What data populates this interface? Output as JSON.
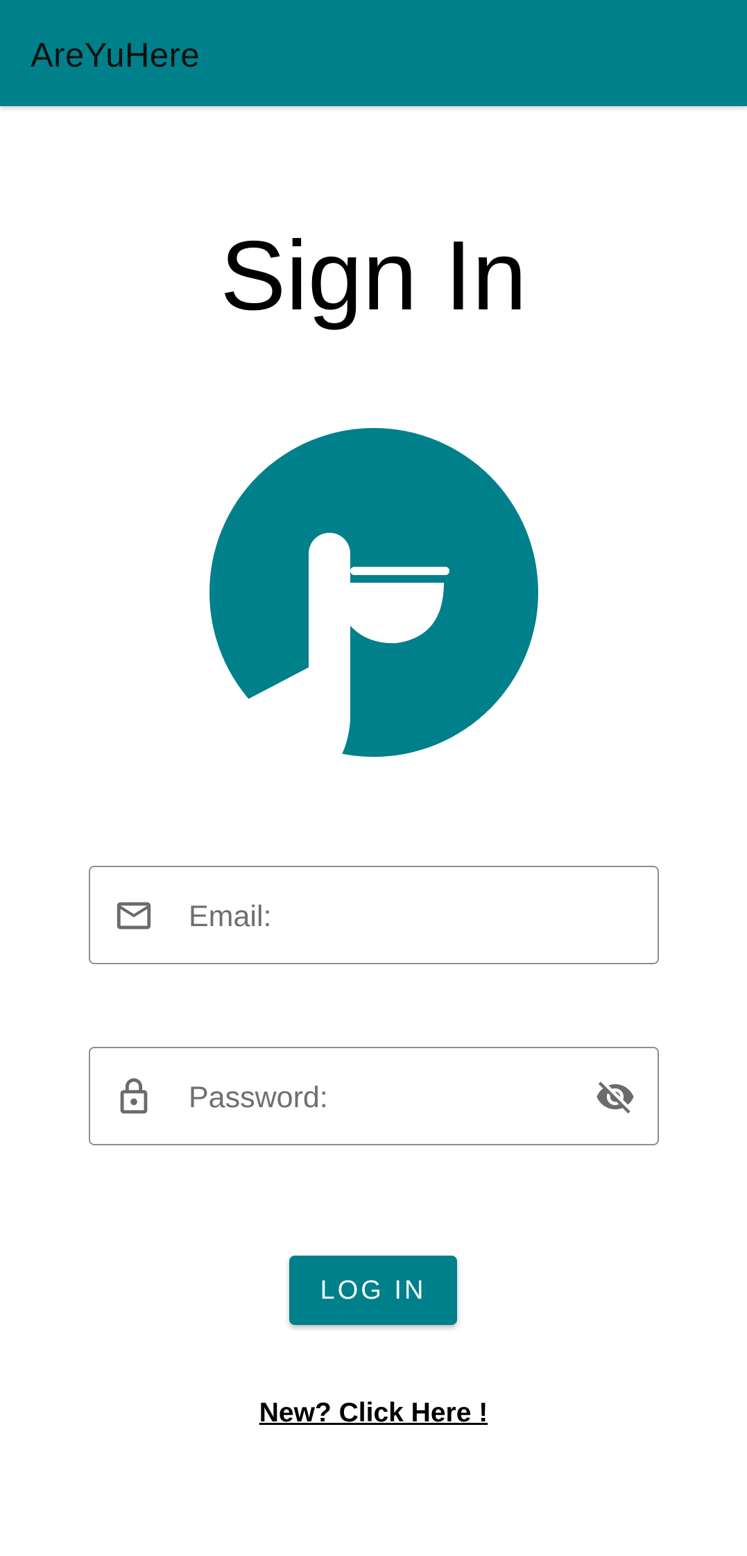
{
  "appbar": {
    "title": "AreYuHere"
  },
  "main": {
    "page_title": "Sign In",
    "email": {
      "placeholder": "Email:",
      "value": "",
      "icon": "mail-icon"
    },
    "password": {
      "placeholder": "Password:",
      "value": "",
      "icon": "lock-icon",
      "toggle_icon": "visibility-off-icon"
    },
    "login_label": "LOG IN",
    "signup_link": "New? Click Here !"
  },
  "colors": {
    "primary": "#00808b",
    "field_border": "#8e8e8e",
    "placeholder": "#6f6f6f"
  }
}
